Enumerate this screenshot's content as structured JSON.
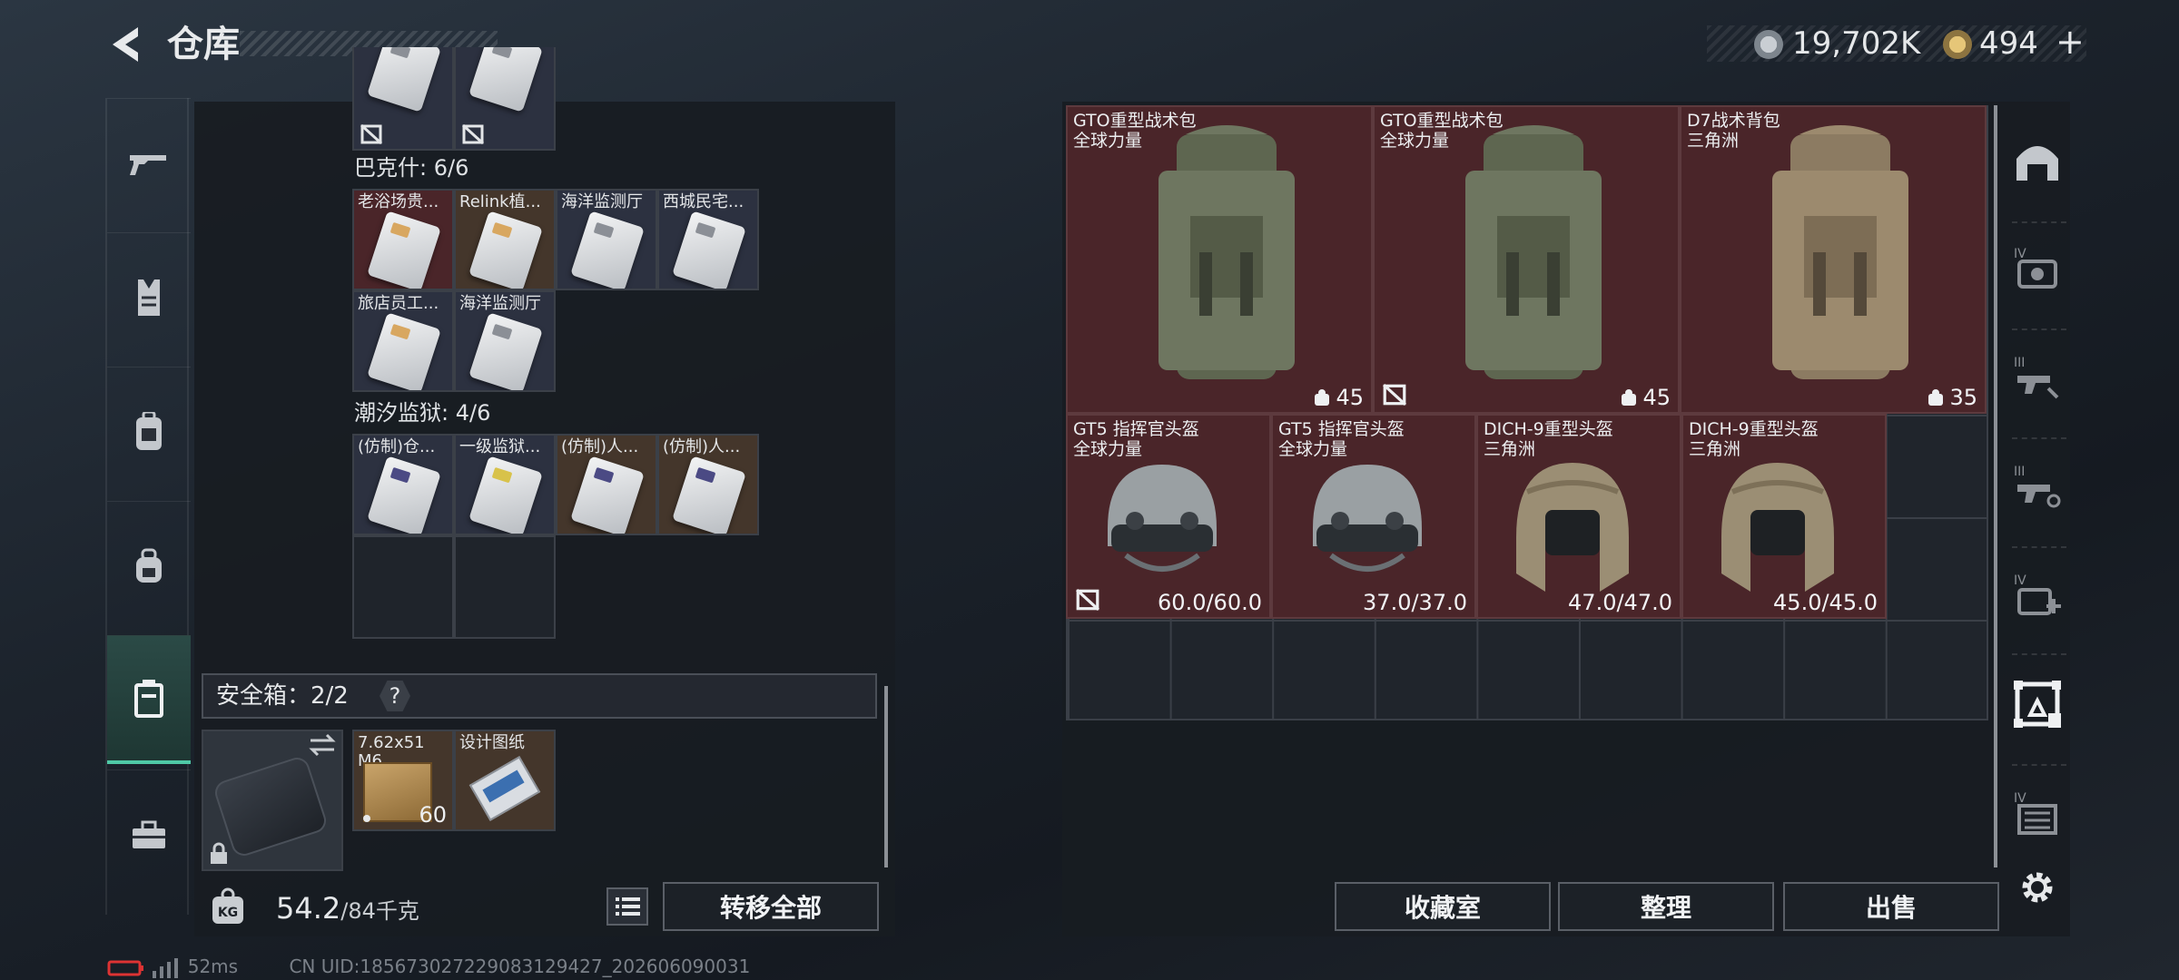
{
  "header": {
    "title": "仓库"
  },
  "currency": {
    "silver": "19,702K",
    "gold": "494",
    "plus": "+"
  },
  "sidebar": {
    "items": [
      "weapon",
      "armor",
      "backpack",
      "bag",
      "safebox",
      "toolbox"
    ],
    "active": "safebox"
  },
  "left_panel": {
    "partial_row": [
      {
        "name": "",
        "color": "slate"
      },
      {
        "name": "",
        "color": "slate"
      }
    ],
    "sections": [
      {
        "label": "巴克什: 6/6",
        "items": [
          {
            "name": "老浴场贵...",
            "color": "red"
          },
          {
            "name": "Relink植...",
            "color": "brown"
          },
          {
            "name": "海洋监测厅",
            "color": "slate"
          },
          {
            "name": "西城民宅...",
            "color": "slate"
          },
          {
            "name": "旅店员工...",
            "color": "slate"
          },
          {
            "name": "海洋监测厅",
            "color": "slate"
          }
        ]
      },
      {
        "label": "潮汐监狱: 4/6",
        "items": [
          {
            "name": "(仿制)仓...",
            "color": "slate"
          },
          {
            "name": "一级监狱...",
            "color": "slate"
          },
          {
            "name": "(仿制)人...",
            "color": "brown"
          },
          {
            "name": "(仿制)人...",
            "color": "brown"
          }
        ]
      }
    ],
    "safebox": {
      "label": "安全箱：2/2",
      "help": "?"
    },
    "safebox_items": [
      {
        "name": "7.62x51",
        "name2": "M6...",
        "count": "60"
      },
      {
        "name": "设计图纸",
        "count": ""
      }
    ],
    "weight": {
      "current": "54.2",
      "max": "/84千克"
    },
    "transfer_label": "转移全部"
  },
  "stash": {
    "backpacks": [
      {
        "name": "GTO重型战术包",
        "sub": "全球力量",
        "capacity": "45",
        "shade": "green",
        "unlinked": false
      },
      {
        "name": "GTO重型战术包",
        "sub": "全球力量",
        "capacity": "45",
        "shade": "green",
        "unlinked": true
      },
      {
        "name": "D7战术背包",
        "sub": "三角洲",
        "capacity": "35",
        "shade": "tan",
        "unlinked": false
      }
    ],
    "helmets": [
      {
        "name": "GT5 指挥官头盔",
        "sub": "全球力量",
        "durability": "60.0/60.0",
        "shade": "gray",
        "unlinked": true
      },
      {
        "name": "GT5 指挥官头盔",
        "sub": "全球力量",
        "durability": "37.0/37.0",
        "shade": "gray",
        "unlinked": false
      },
      {
        "name": "DICH-9重型头盔",
        "sub": "三角洲",
        "durability": "47.0/47.0",
        "shade": "camo",
        "unlinked": false
      },
      {
        "name": "DICH-9重型头盔",
        "sub": "三角洲",
        "durability": "45.0/45.0",
        "shade": "camo",
        "unlinked": false
      }
    ]
  },
  "actions": {
    "collection": "收藏室",
    "organize": "整理",
    "sell": "出售"
  },
  "right_sidebar": [
    {
      "icon": "shelter-icon",
      "tier": ""
    },
    {
      "icon": "armor-station-icon",
      "tier": "IV"
    },
    {
      "icon": "workbench-icon",
      "tier": "III"
    },
    {
      "icon": "tech-center-icon",
      "tier": "III"
    },
    {
      "icon": "medical-station-icon",
      "tier": "IV"
    },
    {
      "icon": "warehouse-expand-icon",
      "tier": ""
    },
    {
      "icon": "storage-icon",
      "tier": "IV"
    }
  ],
  "status": {
    "ping": "52ms",
    "uid": "CN UID:18567302722908312942​7_202606090031"
  }
}
